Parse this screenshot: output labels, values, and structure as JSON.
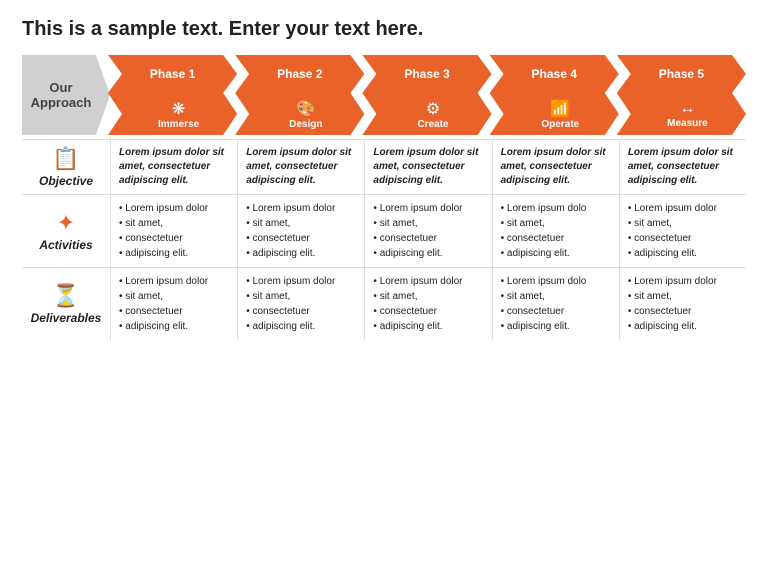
{
  "title": "This is a sample text. Enter your text here.",
  "approach_label": "Our\nApproach",
  "phases": [
    {
      "label": "Phase 1",
      "sublabel": "Immerse",
      "icon": "❋"
    },
    {
      "label": "Phase 2",
      "sublabel": "Design",
      "icon": "🎨"
    },
    {
      "label": "Phase 3",
      "sublabel": "Create",
      "icon": "⚙"
    },
    {
      "label": "Phase 4",
      "sublabel": "Operate",
      "icon": "📶"
    },
    {
      "label": "Phase 5",
      "sublabel": "Measure",
      "icon": "↔"
    }
  ],
  "rows": [
    {
      "id": "objective",
      "label": "Objective",
      "icon": "📋",
      "cells": [
        "Lorem ipsum dolor sit amet, consectetuer adipiscing elit.",
        "Lorem ipsum dolor sit amet, consectetuer adipiscing elit.",
        "Lorem ipsum dolor sit amet, consectetuer adipiscing elit.",
        "Lorem ipsum dolor sit amet, consectetuer adipiscing elit.",
        "Lorem ipsum dolor sit amet, consectetuer adipiscing elit."
      ]
    },
    {
      "id": "activities",
      "label": "Activities",
      "icon": "✦",
      "cells": [
        [
          "Lorem ipsum dolor",
          "sit amet,",
          "consectetuer",
          "adipiscing elit."
        ],
        [
          "Lorem ipsum dolor",
          "sit amet,",
          "consectetuer",
          "adipiscing elit."
        ],
        [
          "Lorem ipsum dolor",
          "sit amet,",
          "consectetuer",
          "adipiscing elit."
        ],
        [
          "Lorem ipsum dolo",
          "sit amet,",
          "consectetuer",
          "adipiscing elit."
        ],
        [
          "Lorem ipsum dolor",
          "sit amet,",
          "consectetuer",
          "adipiscing elit."
        ]
      ]
    },
    {
      "id": "deliverables",
      "label": "Deliverables",
      "icon": "⏳",
      "cells": [
        [
          "Lorem ipsum dolor",
          "sit amet,",
          "consectetuer",
          "adipiscing elit."
        ],
        [
          "Lorem ipsum dolor",
          "sit amet,",
          "consectetuer",
          "adipiscing elit."
        ],
        [
          "Lorem ipsum dolor",
          "sit amet,",
          "consectetuer",
          "adipiscing elit."
        ],
        [
          "Lorem ipsum dolo",
          "sit amet,",
          "consectetuer",
          "adipiscing elit."
        ],
        [
          "Lorem ipsum dolor",
          "sit amet,",
          "consectetuer",
          "adipiscing elit."
        ]
      ]
    }
  ],
  "colors": {
    "accent": "#e8622a",
    "gray": "#d0d0d0",
    "text": "#222222"
  }
}
